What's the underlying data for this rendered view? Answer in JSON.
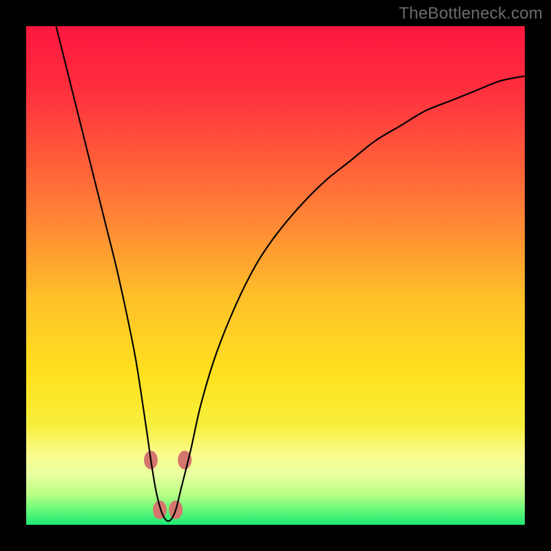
{
  "watermark": "TheBottleneck.com",
  "chart_data": {
    "type": "line",
    "title": "",
    "xlabel": "",
    "ylabel": "",
    "xlim": [
      0,
      100
    ],
    "ylim": [
      0,
      100
    ],
    "grid": false,
    "legend": false,
    "background_gradient_stops": [
      {
        "offset": 0.0,
        "color": "#ff173f"
      },
      {
        "offset": 0.12,
        "color": "#ff2d3e"
      },
      {
        "offset": 0.26,
        "color": "#ff5a3a"
      },
      {
        "offset": 0.4,
        "color": "#ff8a34"
      },
      {
        "offset": 0.55,
        "color": "#ffc229"
      },
      {
        "offset": 0.7,
        "color": "#ffe11e"
      },
      {
        "offset": 0.8,
        "color": "#f7ef3b"
      },
      {
        "offset": 0.86,
        "color": "#fbfb90"
      },
      {
        "offset": 0.9,
        "color": "#e8ffa0"
      },
      {
        "offset": 0.94,
        "color": "#b6ff84"
      },
      {
        "offset": 0.97,
        "color": "#66f97a"
      },
      {
        "offset": 1.0,
        "color": "#1de874"
      }
    ],
    "series": [
      {
        "name": "bottleneck-curve",
        "color": "#000000",
        "x": [
          6,
          8,
          10,
          12,
          14,
          16,
          18,
          20,
          22,
          24,
          25,
          26,
          27,
          28,
          29,
          30,
          31,
          33,
          35,
          38,
          42,
          46,
          50,
          55,
          60,
          65,
          70,
          75,
          80,
          85,
          90,
          95,
          100
        ],
        "y": [
          100,
          92,
          84,
          76,
          68,
          60,
          52,
          43,
          33,
          20,
          13,
          7,
          3,
          1,
          1,
          3,
          7,
          15,
          24,
          34,
          44,
          52,
          58,
          64,
          69,
          73,
          77,
          80,
          83,
          85,
          87,
          89,
          90
        ]
      }
    ],
    "markers": [
      {
        "name": "marker-left-upper",
        "x": 25.0,
        "y": 13,
        "color": "#d5766e",
        "r": 10
      },
      {
        "name": "marker-left-lower",
        "x": 26.8,
        "y": 3,
        "color": "#d5766e",
        "r": 10
      },
      {
        "name": "marker-right-lower",
        "x": 30.0,
        "y": 3,
        "color": "#d5766e",
        "r": 10
      },
      {
        "name": "marker-right-upper",
        "x": 31.8,
        "y": 13,
        "color": "#d5766e",
        "r": 10
      }
    ],
    "minimum": {
      "x": 28.5,
      "y": 0.5
    }
  }
}
